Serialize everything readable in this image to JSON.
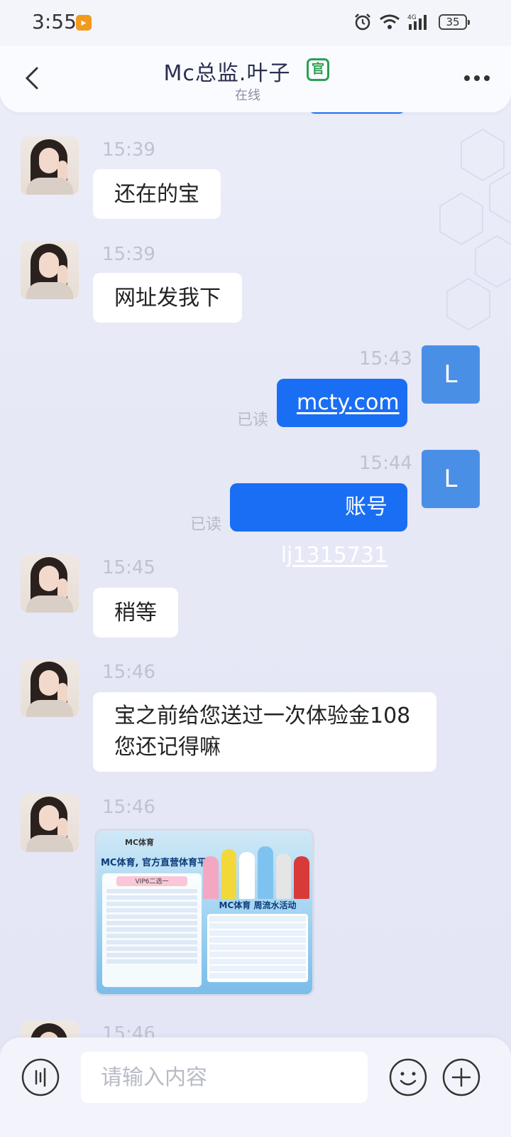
{
  "status_bar": {
    "time": "3:55",
    "battery": "35",
    "icons": [
      "alarm-icon",
      "wifi-icon",
      "signal-4g-icon",
      "battery-icon"
    ]
  },
  "header": {
    "title": "Mc总监.叶子",
    "badge": "官",
    "status": "在线",
    "badge_color": "#2aa053"
  },
  "messages": [
    {
      "side": "left",
      "time": "15:39",
      "text": "还在的宝"
    },
    {
      "side": "left",
      "time": "15:39",
      "text": "网址发我下"
    },
    {
      "side": "right",
      "time": "15:43",
      "text": "mcty.com",
      "read": "已读",
      "avatar": "L"
    },
    {
      "side": "right",
      "time": "15:44",
      "text_prefix": "账号lj",
      "text_link": "1315731",
      "read": "已读",
      "avatar": "L"
    },
    {
      "side": "left",
      "time": "15:45",
      "text": "稍等"
    },
    {
      "side": "left",
      "time": "15:46",
      "line1": "宝之前给您送过一次体验金108",
      "line2": "您还记得嘛"
    },
    {
      "side": "left",
      "time": "15:46",
      "image": {
        "brand": "MC体育",
        "headline": "MC体育, 官方直营体育平台",
        "vip": "VIP6二选一",
        "activity": "MC体育 周流水活动"
      }
    },
    {
      "side": "left",
      "time": "15:46"
    }
  ],
  "input": {
    "placeholder": "请输入内容"
  },
  "colors": {
    "accent": "#1a6ef3",
    "avatar_l": "#4a8fe6",
    "background": "#e8eaf7"
  }
}
